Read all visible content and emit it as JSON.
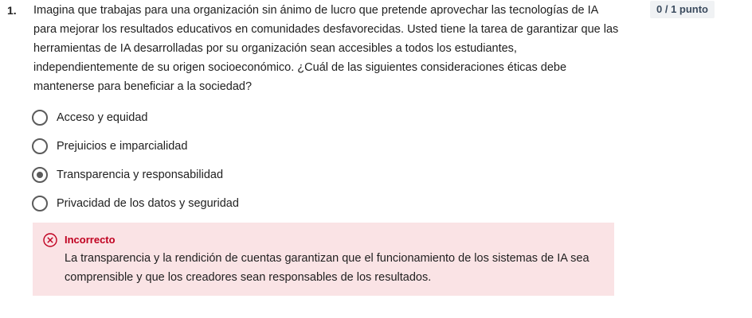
{
  "question": {
    "number": "1.",
    "text": "Imagina que trabajas para una organización sin ánimo de lucro que pretende aprovechar las tecnologías de IA para mejorar los resultados educativos en comunidades desfavorecidas. Usted tiene la tarea de garantizar que las herramientas de IA desarrolladas por su organización sean accesibles a todos los estudiantes, independientemente de su origen socioeconómico. ¿Cuál de las siguientes consideraciones éticas debe mantenerse para beneficiar a la sociedad?",
    "score": "0 / 1 punto"
  },
  "options": [
    {
      "label": "Acceso y equidad",
      "selected": false
    },
    {
      "label": "Prejuicios e imparcialidad",
      "selected": false
    },
    {
      "label": "Transparencia y responsabilidad",
      "selected": true
    },
    {
      "label": "Privacidad de los datos y seguridad",
      "selected": false
    }
  ],
  "feedback": {
    "status": "Incorrecto",
    "icon": "x-circle-icon",
    "message": "La transparencia y la rendición de cuentas garantizan que el funcionamiento de los sistemas de IA sea comprensible y que los creadores sean responsables de los resultados."
  },
  "colors": {
    "error": "#c00020",
    "feedback_bg": "#fae3e5",
    "badge_bg": "#f0f2f4",
    "radio": "#5b5b5b"
  }
}
